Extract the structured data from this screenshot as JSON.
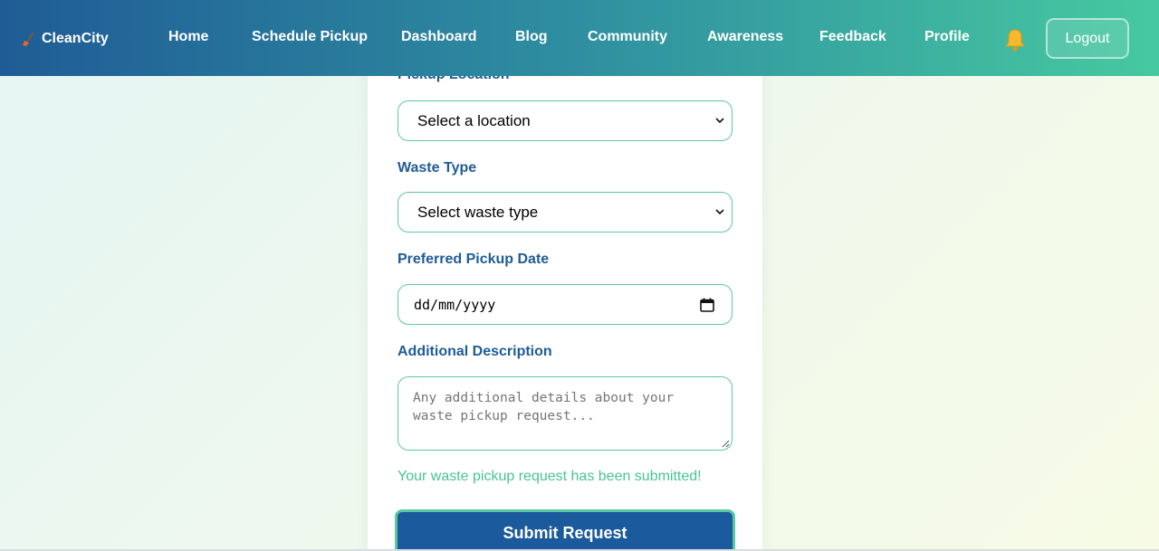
{
  "brand": {
    "name": "CleanCity",
    "icon": "broom-icon"
  },
  "nav": {
    "items": [
      {
        "label": "Home"
      },
      {
        "label": "Schedule Pickup"
      },
      {
        "label": "Dashboard"
      },
      {
        "label": "Blog"
      },
      {
        "label": "Community"
      },
      {
        "label": "Awareness"
      },
      {
        "label": "Feedback"
      },
      {
        "label": "Profile"
      }
    ],
    "bell_icon": "bell-icon",
    "logout_label": "Logout"
  },
  "form": {
    "location": {
      "label": "Pickup Location",
      "selected": "Select a location"
    },
    "waste_type": {
      "label": "Waste Type",
      "selected": "Select waste type"
    },
    "date": {
      "label": "Preferred Pickup Date",
      "value": "dd/mm/yyyy"
    },
    "description": {
      "label": "Additional Description",
      "placeholder": "Any additional details about your waste pickup request..."
    },
    "success_message": "Your waste pickup request has been submitted!",
    "submit_label": "Submit Request"
  },
  "colors": {
    "nav_start": "#1f5c96",
    "nav_end": "#46c9a0",
    "label": "#1f5c96",
    "accent": "#5cc8a0",
    "success": "#47c496",
    "button": "#1b5a9c"
  }
}
